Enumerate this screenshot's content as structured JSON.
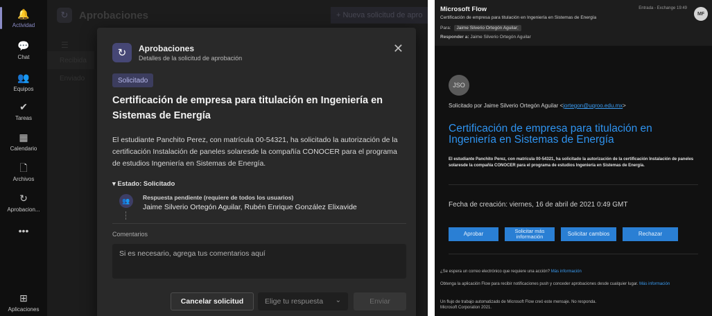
{
  "teams": {
    "rail": [
      {
        "label": "Actividad",
        "icon": "bell-icon",
        "glyph": "🔔"
      },
      {
        "label": "Chat",
        "icon": "chat-icon",
        "glyph": "💬"
      },
      {
        "label": "Equipos",
        "icon": "teams-icon",
        "glyph": "👥"
      },
      {
        "label": "Tareas",
        "icon": "tasks-icon",
        "glyph": "✔"
      },
      {
        "label": "Calendario",
        "icon": "calendar-icon",
        "glyph": "▦"
      },
      {
        "label": "Archivos",
        "icon": "files-icon",
        "glyph": "🗋"
      },
      {
        "label": "Aprobacion...",
        "icon": "approvals-icon",
        "glyph": "↻"
      },
      {
        "label": "",
        "icon": "more-icon",
        "glyph": "•••"
      },
      {
        "label": "Aplicaciones",
        "icon": "apps-icon",
        "glyph": "⊞"
      }
    ],
    "header_title": "Aprobaciones",
    "new_request": "+ Nueva solicitud de apro",
    "sub_tabs": [
      "Recibida",
      "Enviado"
    ],
    "modal": {
      "app_name": "Aprobaciones",
      "subtitle": "Detalles de la solicitud de aprobación",
      "status": "Solicitado",
      "title": "Certificación de empresa para titulación en Ingeniería en Sistemas de Energía",
      "body": "El estudiante Panchito Perez, con matrícula 00-54321, ha solicitado la autorización de la certificación Instalación de paneles solaresde la compañía CONOCER para el programa de estudios Ingeniería en Sistemas de Energía.",
      "estado": "Estado: Solicitado",
      "approver_label": "Respuesta pendiente (requiere de todos los usuarios)",
      "approver_names": "Jaime Silverio Ortegón Aguilar, Rubén Enrique González Elixavide",
      "comments_label": "Comentarios",
      "comments_placeholder": "Si es necesario, agrega tus comentarios aquí",
      "cancel_label": "Cancelar solicitud",
      "response_placeholder": "Elige tu respuesta",
      "send_label": "Enviar"
    }
  },
  "email": {
    "from": "Microsoft Flow",
    "subject": "Certificación de empresa para titulación en Ingeniería en Sistemas de Energía",
    "to_label": "Para:",
    "to_value": "Jaime Silverio Ortegón Aguilar;",
    "reply_label": "Responder a:",
    "reply_value": "Jaime Silverio Ortegón Aguilar",
    "folder": "Entrada - Exchange   19:49",
    "avatar_initials": "MF",
    "sender_initials": "JSO",
    "requested_by": "Solicitado por Jaime Silverio Ortegón Aguilar <",
    "requested_email": "jortegon@uqroo.edu.mx",
    "requested_close": ">",
    "title": "Certificación de empresa para titulación en Ingeniería en Sistemas de Energía",
    "description": "El estudiante Panchito Perez, con matrícula 00-54321, ha solicitado la autorización de la certificación Instalación de paneles solaresde la compañía CONOCER para el programa de estudios Ingeniería en Sistemas de Energía.",
    "created": "Fecha de creación: viernes, 16 de abril de 2021 0:49 GMT",
    "buttons": {
      "approve": "Aprobar",
      "more_info": "Solicitar más información",
      "changes": "Solicitar cambios",
      "reject": "Rechazar"
    },
    "note1_text": "¿Se espera un correo electrónico que requiere una acción? ",
    "note1_link": "Más información",
    "note2_text": "Obtenga la aplicación Flow para recibir notificaciones push y conceder aprobaciones desde cualquier lugar. ",
    "note2_link": "Más información",
    "note3": "Un flujo de trabajo automatizado de Microsoft Flow creó este mensaje. No responda.",
    "note4": "Microsoft Corporation 2021."
  },
  "colors": {
    "teams_accent": "#8b8cc7",
    "email_link": "#2e93f0",
    "email_button": "#2a7fd4"
  }
}
